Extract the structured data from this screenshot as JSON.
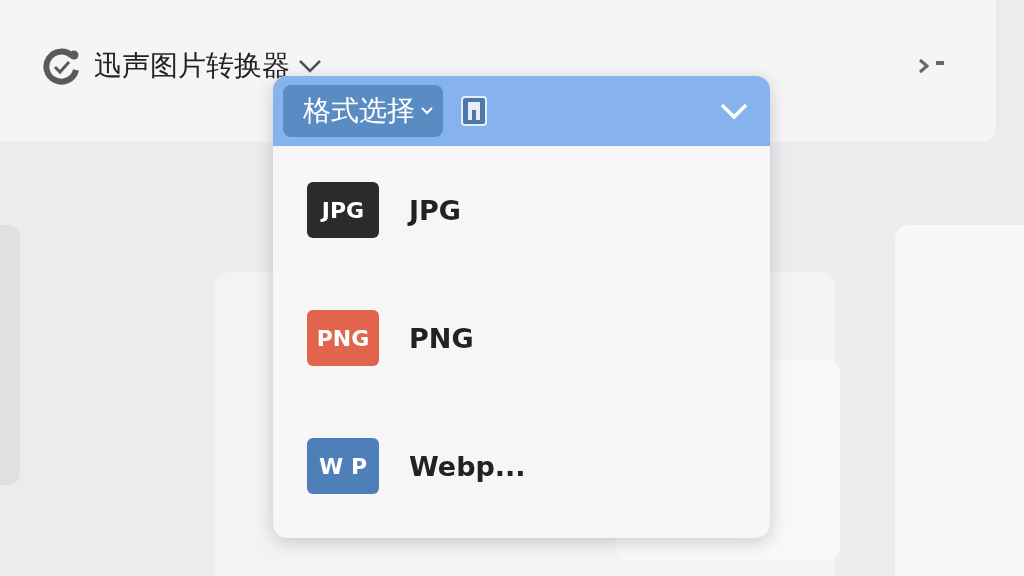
{
  "header": {
    "app_title": "迅声图片转换器"
  },
  "dropdown": {
    "button_label": "格式选择",
    "expanded": true,
    "items": [
      {
        "badge": "JPG",
        "label": "JPG",
        "color": "#2b2b2b"
      },
      {
        "badge": "PNG",
        "label": "PNG",
        "color": "#e0654c"
      },
      {
        "badge": "W P",
        "label": "Webp...",
        "color": "#4f7fb8"
      }
    ]
  }
}
